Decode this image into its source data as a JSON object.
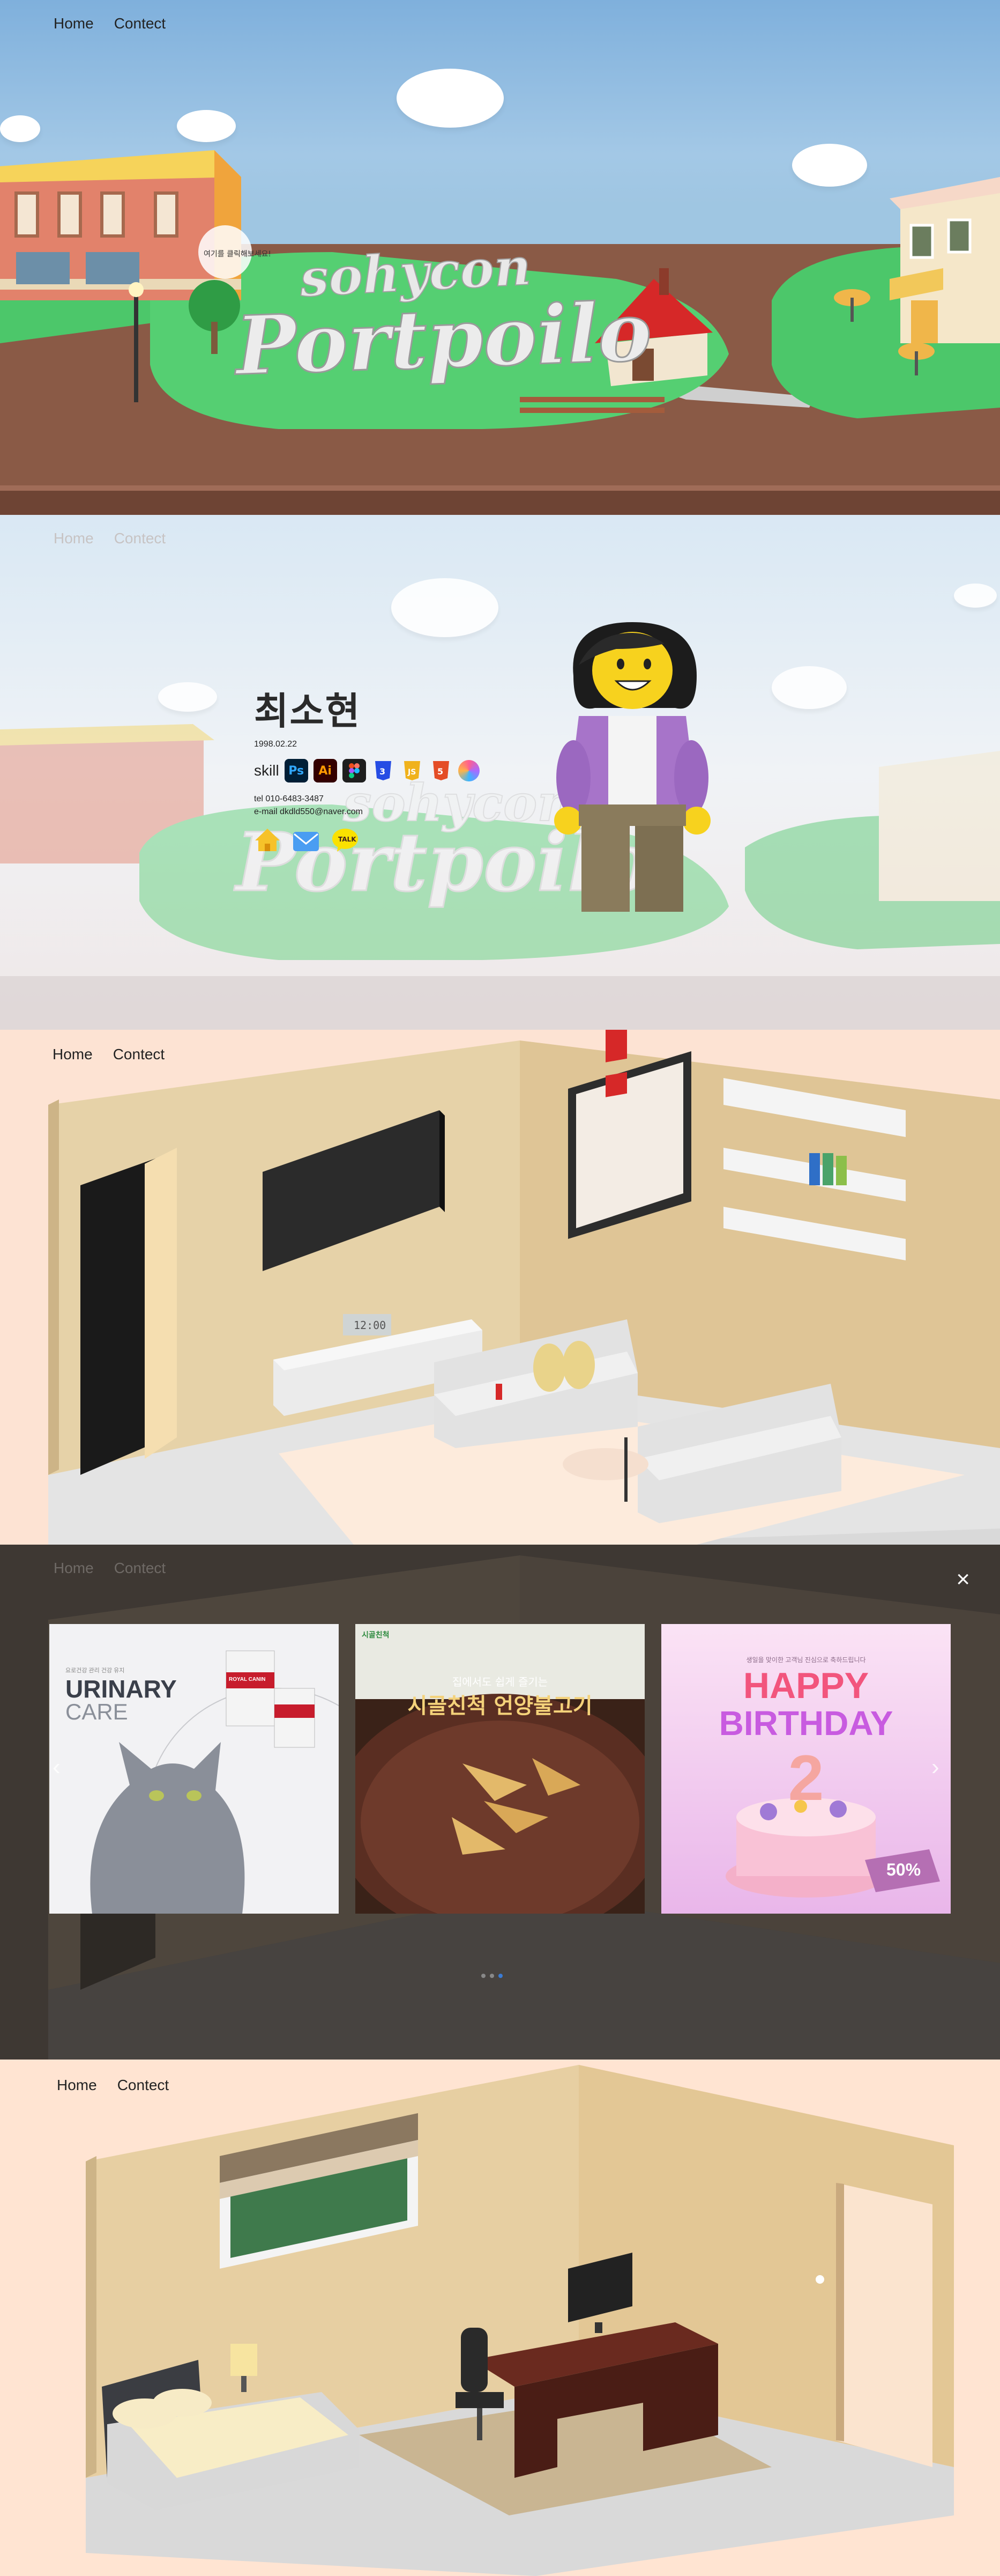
{
  "nav": {
    "home": "Home",
    "contact": "Contect"
  },
  "hero": {
    "title_top": "sohycon",
    "title_main": "Portpoilo",
    "sign_text": "여기를 클릭해보세요!"
  },
  "profile": {
    "name": "최소현",
    "birth": "1998.02.22",
    "skill_label": "skill",
    "skills": [
      "Ps",
      "Ai",
      "Figma",
      "CSS",
      "JS",
      "HTML",
      "Color"
    ],
    "tel": "tel 010-6483-3487",
    "email": "e-mail dkdld550@naver.com",
    "kakao_label": "TALK"
  },
  "room1": {
    "clock": "12:00"
  },
  "gallery": {
    "close_label": "×",
    "slide1": {
      "subtitle": "요로건강 관리 건강 유지",
      "title1": "URINARY",
      "title2": "CARE",
      "brand": "ROYAL CANIN"
    },
    "slide2": {
      "logo": "시골친척",
      "subtitle": "집에서도 쉽게 즐기는",
      "title": "시골친척 언양불고기"
    },
    "slide3": {
      "subtitle": "생일을 맞이한 고객님 진심으로 축하드립니다",
      "line1": "HAPPY",
      "line2": "BIRTHDAY",
      "number": "2",
      "discount": "50%"
    },
    "dots": 3,
    "active_dot": 3
  },
  "colors": {
    "grass": "#4cc76a",
    "ground": "#8a5a46",
    "sky": "#8fbde2",
    "wall": "#e6d2a8",
    "accent_red": "#d62828"
  }
}
